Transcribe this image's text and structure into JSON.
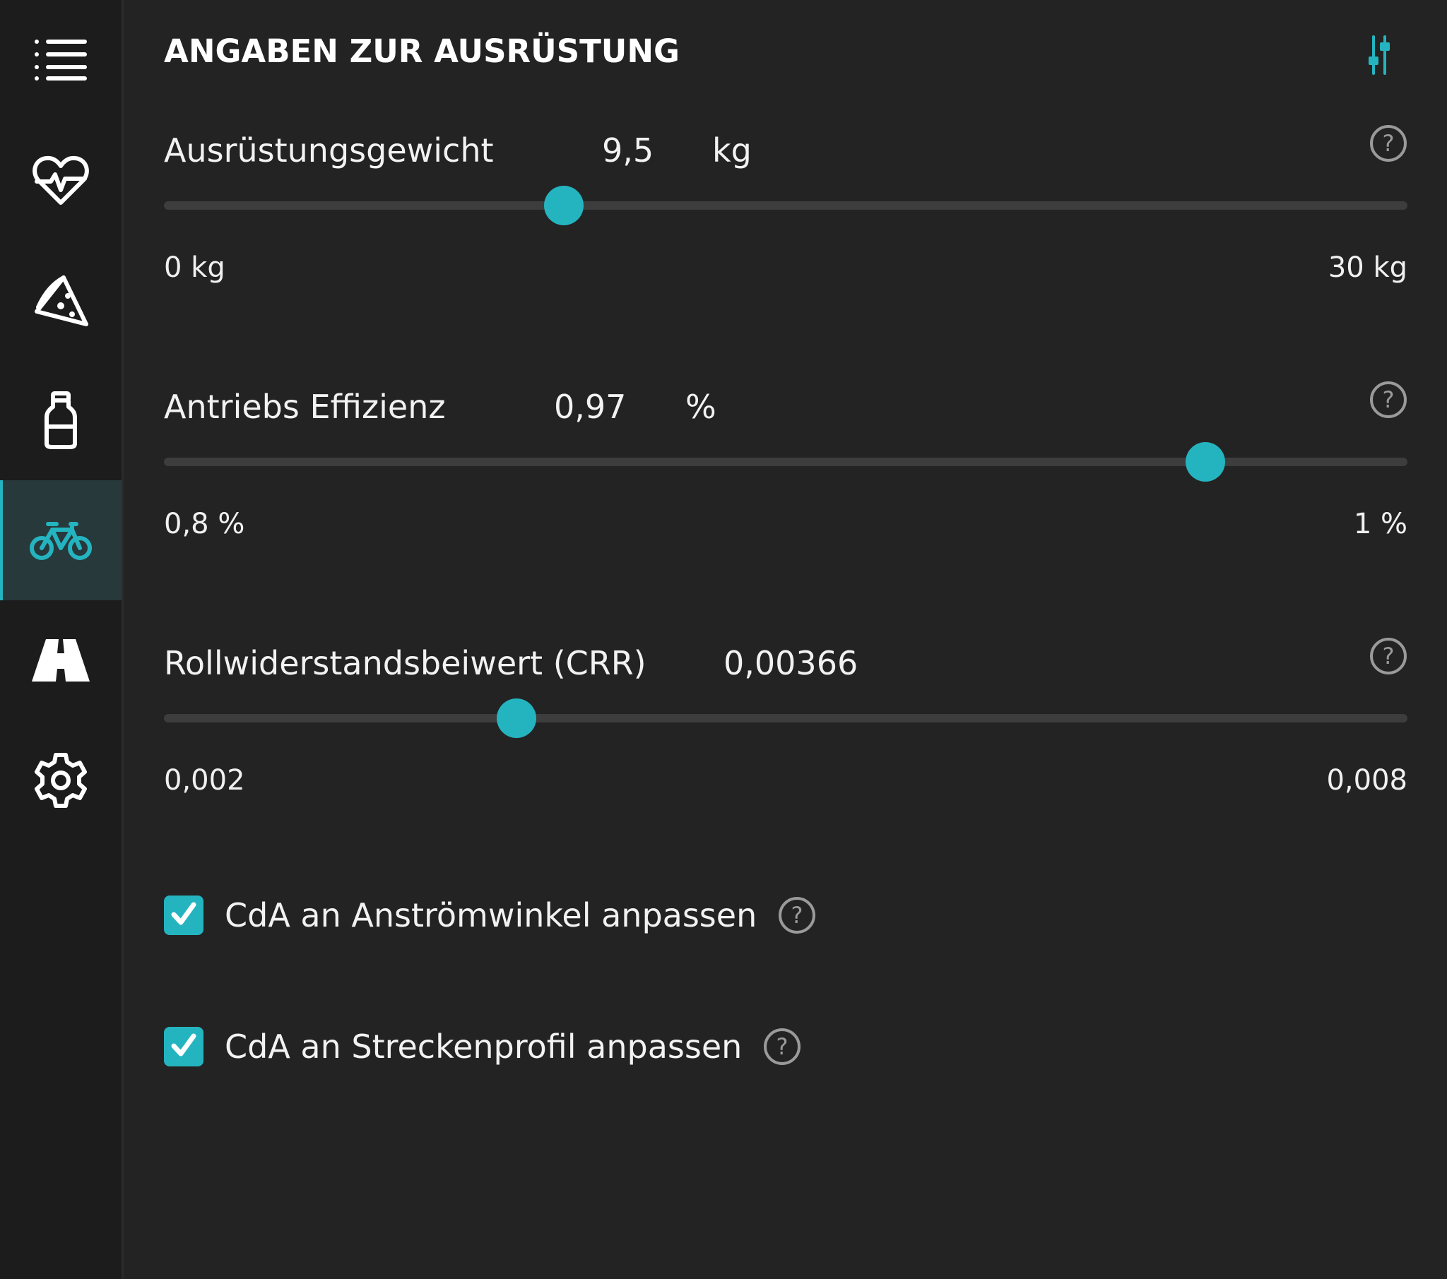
{
  "colors": {
    "accent": "#24b4c0",
    "background": "#232323",
    "sidebar": "#1c1c1c",
    "track": "#3d3d3d"
  },
  "sidebar": {
    "items": [
      {
        "icon": "menu-icon",
        "active": false
      },
      {
        "icon": "heart-pulse-icon",
        "active": false
      },
      {
        "icon": "pizza-slice-icon",
        "active": false
      },
      {
        "icon": "bottle-icon",
        "active": false
      },
      {
        "icon": "bicycle-icon",
        "active": true
      },
      {
        "icon": "road-icon",
        "active": false
      },
      {
        "icon": "gear-icon",
        "active": false
      }
    ]
  },
  "header": {
    "title": "ANGABEN ZUR AUSRÜSTUNG",
    "settings_icon": "sliders-icon"
  },
  "sliders": [
    {
      "label": "Ausrüstungsgewicht",
      "value": "9,5",
      "unit": "kg",
      "min_label": "0 kg",
      "max_label": "30 kg",
      "min": 0,
      "max": 30,
      "current": 9.65
    },
    {
      "label": "Antriebs Effizienz",
      "value": "0,97",
      "unit": "%",
      "min_label": "0,8 %",
      "max_label": "1 %",
      "min": 0.8,
      "max": 1.0,
      "current": 0.9675
    },
    {
      "label": "Rollwiderstandsbeiwert (CRR)",
      "value": "0,00366",
      "unit": "",
      "min_label": "0,002",
      "max_label": "0,008",
      "min": 0.002,
      "max": 0.008,
      "current": 0.0037
    }
  ],
  "checkboxes": [
    {
      "label": "CdA an Anströmwinkel anpassen",
      "checked": true
    },
    {
      "label": "CdA an Streckenprofil anpassen",
      "checked": true
    }
  ]
}
